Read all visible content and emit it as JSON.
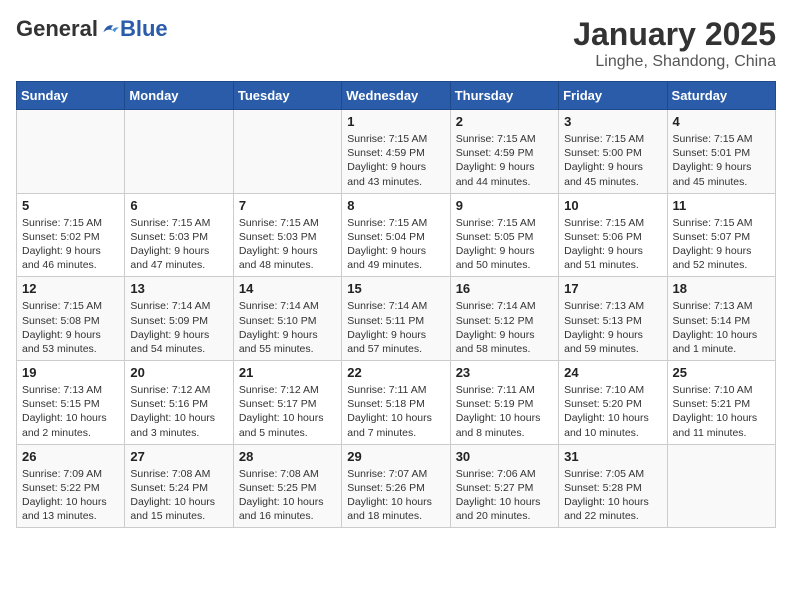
{
  "header": {
    "logo_general": "General",
    "logo_blue": "Blue",
    "month": "January 2025",
    "location": "Linghe, Shandong, China"
  },
  "weekdays": [
    "Sunday",
    "Monday",
    "Tuesday",
    "Wednesday",
    "Thursday",
    "Friday",
    "Saturday"
  ],
  "weeks": [
    [
      {
        "day": "",
        "text": ""
      },
      {
        "day": "",
        "text": ""
      },
      {
        "day": "",
        "text": ""
      },
      {
        "day": "1",
        "text": "Sunrise: 7:15 AM\nSunset: 4:59 PM\nDaylight: 9 hours and 43 minutes."
      },
      {
        "day": "2",
        "text": "Sunrise: 7:15 AM\nSunset: 4:59 PM\nDaylight: 9 hours and 44 minutes."
      },
      {
        "day": "3",
        "text": "Sunrise: 7:15 AM\nSunset: 5:00 PM\nDaylight: 9 hours and 45 minutes."
      },
      {
        "day": "4",
        "text": "Sunrise: 7:15 AM\nSunset: 5:01 PM\nDaylight: 9 hours and 45 minutes."
      }
    ],
    [
      {
        "day": "5",
        "text": "Sunrise: 7:15 AM\nSunset: 5:02 PM\nDaylight: 9 hours and 46 minutes."
      },
      {
        "day": "6",
        "text": "Sunrise: 7:15 AM\nSunset: 5:03 PM\nDaylight: 9 hours and 47 minutes."
      },
      {
        "day": "7",
        "text": "Sunrise: 7:15 AM\nSunset: 5:03 PM\nDaylight: 9 hours and 48 minutes."
      },
      {
        "day": "8",
        "text": "Sunrise: 7:15 AM\nSunset: 5:04 PM\nDaylight: 9 hours and 49 minutes."
      },
      {
        "day": "9",
        "text": "Sunrise: 7:15 AM\nSunset: 5:05 PM\nDaylight: 9 hours and 50 minutes."
      },
      {
        "day": "10",
        "text": "Sunrise: 7:15 AM\nSunset: 5:06 PM\nDaylight: 9 hours and 51 minutes."
      },
      {
        "day": "11",
        "text": "Sunrise: 7:15 AM\nSunset: 5:07 PM\nDaylight: 9 hours and 52 minutes."
      }
    ],
    [
      {
        "day": "12",
        "text": "Sunrise: 7:15 AM\nSunset: 5:08 PM\nDaylight: 9 hours and 53 minutes."
      },
      {
        "day": "13",
        "text": "Sunrise: 7:14 AM\nSunset: 5:09 PM\nDaylight: 9 hours and 54 minutes."
      },
      {
        "day": "14",
        "text": "Sunrise: 7:14 AM\nSunset: 5:10 PM\nDaylight: 9 hours and 55 minutes."
      },
      {
        "day": "15",
        "text": "Sunrise: 7:14 AM\nSunset: 5:11 PM\nDaylight: 9 hours and 57 minutes."
      },
      {
        "day": "16",
        "text": "Sunrise: 7:14 AM\nSunset: 5:12 PM\nDaylight: 9 hours and 58 minutes."
      },
      {
        "day": "17",
        "text": "Sunrise: 7:13 AM\nSunset: 5:13 PM\nDaylight: 9 hours and 59 minutes."
      },
      {
        "day": "18",
        "text": "Sunrise: 7:13 AM\nSunset: 5:14 PM\nDaylight: 10 hours and 1 minute."
      }
    ],
    [
      {
        "day": "19",
        "text": "Sunrise: 7:13 AM\nSunset: 5:15 PM\nDaylight: 10 hours and 2 minutes."
      },
      {
        "day": "20",
        "text": "Sunrise: 7:12 AM\nSunset: 5:16 PM\nDaylight: 10 hours and 3 minutes."
      },
      {
        "day": "21",
        "text": "Sunrise: 7:12 AM\nSunset: 5:17 PM\nDaylight: 10 hours and 5 minutes."
      },
      {
        "day": "22",
        "text": "Sunrise: 7:11 AM\nSunset: 5:18 PM\nDaylight: 10 hours and 7 minutes."
      },
      {
        "day": "23",
        "text": "Sunrise: 7:11 AM\nSunset: 5:19 PM\nDaylight: 10 hours and 8 minutes."
      },
      {
        "day": "24",
        "text": "Sunrise: 7:10 AM\nSunset: 5:20 PM\nDaylight: 10 hours and 10 minutes."
      },
      {
        "day": "25",
        "text": "Sunrise: 7:10 AM\nSunset: 5:21 PM\nDaylight: 10 hours and 11 minutes."
      }
    ],
    [
      {
        "day": "26",
        "text": "Sunrise: 7:09 AM\nSunset: 5:22 PM\nDaylight: 10 hours and 13 minutes."
      },
      {
        "day": "27",
        "text": "Sunrise: 7:08 AM\nSunset: 5:24 PM\nDaylight: 10 hours and 15 minutes."
      },
      {
        "day": "28",
        "text": "Sunrise: 7:08 AM\nSunset: 5:25 PM\nDaylight: 10 hours and 16 minutes."
      },
      {
        "day": "29",
        "text": "Sunrise: 7:07 AM\nSunset: 5:26 PM\nDaylight: 10 hours and 18 minutes."
      },
      {
        "day": "30",
        "text": "Sunrise: 7:06 AM\nSunset: 5:27 PM\nDaylight: 10 hours and 20 minutes."
      },
      {
        "day": "31",
        "text": "Sunrise: 7:05 AM\nSunset: 5:28 PM\nDaylight: 10 hours and 22 minutes."
      },
      {
        "day": "",
        "text": ""
      }
    ]
  ]
}
